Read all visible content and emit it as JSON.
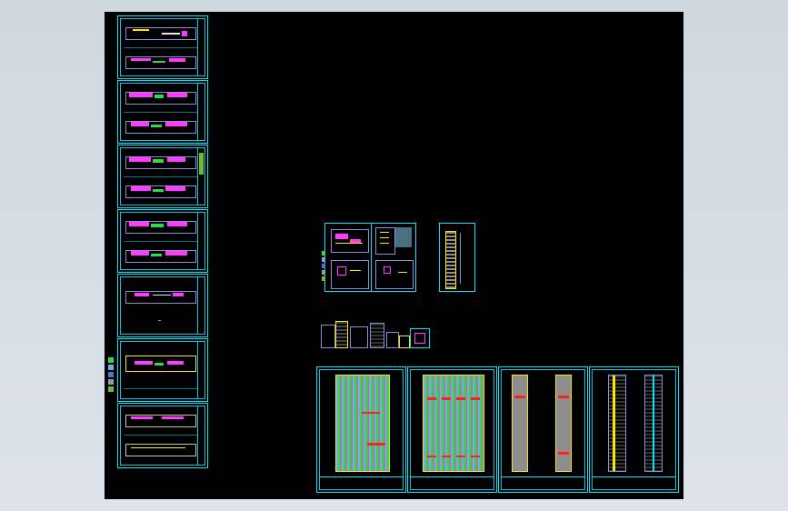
{
  "window": {
    "name": "cad-model-space",
    "background_color": "#000000",
    "frame_color": "#dde3e8"
  },
  "colors": {
    "sheet_border": "#00e5ff",
    "walls": "#8a8fd8",
    "magenta_layer": "#ff3bff",
    "green_layer": "#32d74b",
    "yellow_layer": "#ffe600",
    "red_layer": "#ff2020",
    "grey_fill": "#8d8d8d"
  },
  "drawing_sets": {
    "floor_plan_sheets_count": 7,
    "detail_sheets_count": 3,
    "small_elevation_strip_count": 1,
    "large_elevation_sheets_count": 4
  },
  "icons": {
    "ucs": "ucs-icon"
  }
}
